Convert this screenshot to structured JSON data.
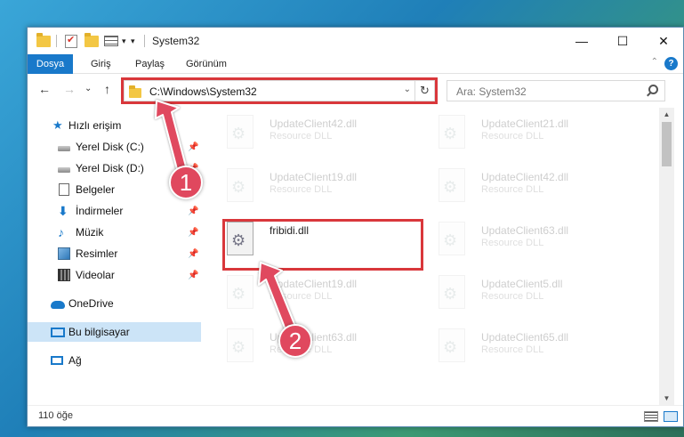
{
  "window": {
    "title": "System32",
    "minimize_glyph": "—",
    "maximize_glyph": "☐",
    "close_glyph": "✕"
  },
  "ribbon": {
    "tabs": [
      {
        "label": "Dosya"
      },
      {
        "label": "Giriş"
      },
      {
        "label": "Paylaş"
      },
      {
        "label": "Görünüm"
      }
    ],
    "help_glyph": "?",
    "collapse_glyph": "⌃"
  },
  "nav": {
    "back_glyph": "←",
    "forward_glyph": "→",
    "recent_glyph": "⌄",
    "up_glyph": "↑",
    "address": "C:\\Windows\\System32",
    "address_dropdown_glyph": "⌄",
    "refresh_glyph": "↻",
    "search_placeholder": "Ara: System32"
  },
  "sidebar": {
    "items": [
      {
        "label": "Hızlı erişim",
        "icon": "star-icon",
        "pinned": false
      },
      {
        "label": "Yerel Disk (C:)",
        "icon": "disk-icon",
        "pinned": true
      },
      {
        "label": "Yerel Disk (D:)",
        "icon": "disk-icon",
        "pinned": true
      },
      {
        "label": "Belgeler",
        "icon": "document-icon",
        "pinned": true
      },
      {
        "label": "İndirmeler",
        "icon": "download-icon",
        "pinned": true
      },
      {
        "label": "Müzik",
        "icon": "music-icon",
        "pinned": true
      },
      {
        "label": "Resimler",
        "icon": "pictures-icon",
        "pinned": true
      },
      {
        "label": "Videolar",
        "icon": "video-icon",
        "pinned": true
      },
      {
        "label": "OneDrive",
        "icon": "cloud-icon",
        "pinned": false
      },
      {
        "label": "Bu bilgisayar",
        "icon": "computer-icon",
        "pinned": false,
        "selected": true
      },
      {
        "label": "Ağ",
        "icon": "network-icon",
        "pinned": false
      }
    ],
    "pin_glyph": "📌"
  },
  "files": [
    {
      "name": "UpdateClient42.dll",
      "type": "Resource DLL",
      "faded": true
    },
    {
      "name": "UpdateClient21.dll",
      "type": "Resource DLL",
      "faded": true
    },
    {
      "name": "UpdateClient19.dll",
      "type": "Resource DLL",
      "faded": true
    },
    {
      "name": "UpdateClient42.dll",
      "type": "Resource DLL",
      "faded": true
    },
    {
      "name": "fribidi.dll",
      "type": "",
      "faded": false,
      "highlighted": true
    },
    {
      "name": "UpdateClient63.dll",
      "type": "Resource DLL",
      "faded": true
    },
    {
      "name": "UpdateClient19.dll",
      "type": "Resource DLL",
      "faded": true
    },
    {
      "name": "UpdateClient5.dll",
      "type": "Resource DLL",
      "faded": true
    },
    {
      "name": "UpdateClient63.dll",
      "type": "Resource DLL",
      "faded": true
    },
    {
      "name": "UpdateClient65.dll",
      "type": "Resource DLL",
      "faded": true
    }
  ],
  "status": {
    "item_count": "110 öğe"
  },
  "scrollbar": {
    "up_glyph": "▲",
    "down_glyph": "▼"
  },
  "annotations": {
    "step1": "1",
    "step2": "2",
    "color": "#d9373b"
  }
}
